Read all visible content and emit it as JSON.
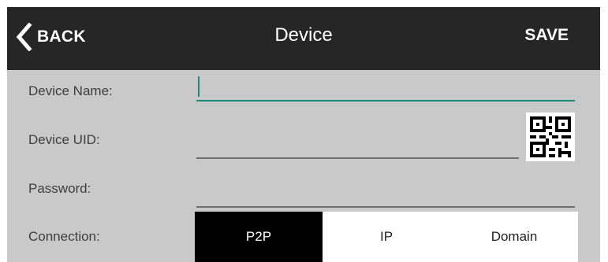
{
  "header": {
    "back_label": "BACK",
    "title": "Device",
    "save_label": "SAVE"
  },
  "form": {
    "device_name": {
      "label": "Device Name:",
      "value": ""
    },
    "device_uid": {
      "label": "Device UID:",
      "value": ""
    },
    "password": {
      "label": "Password:",
      "value": ""
    },
    "connection": {
      "label": "Connection:",
      "options": [
        "P2P",
        "IP",
        "Domain"
      ],
      "selected": "P2P"
    }
  },
  "icons": {
    "back": "chevron-left-icon",
    "qr": "qr-code-icon"
  },
  "colors": {
    "header_bg": "#262626",
    "body_bg": "#c9c9c9",
    "accent": "#1f8a7a",
    "selected_segment": "#000000"
  }
}
